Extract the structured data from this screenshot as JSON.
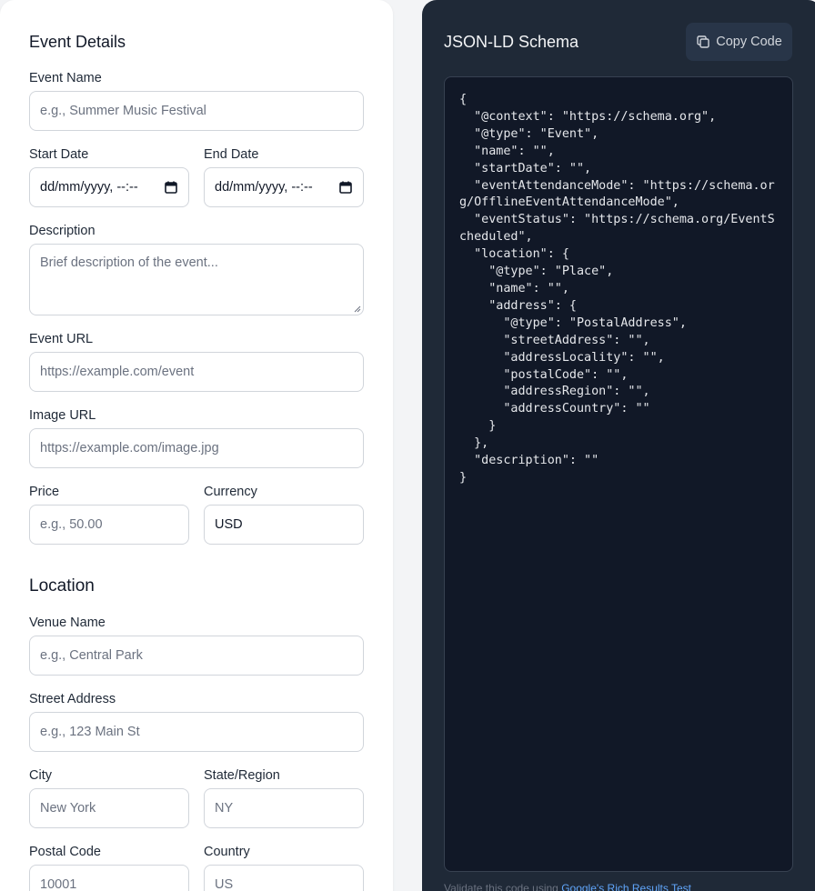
{
  "event_details": {
    "title": "Event Details",
    "event_name": {
      "label": "Event Name",
      "placeholder": "e.g., Summer Music Festival"
    },
    "start_date": {
      "label": "Start Date",
      "value": "dd/mm/yyyy, --:--"
    },
    "end_date": {
      "label": "End Date",
      "value": "dd/mm/yyyy, --:--"
    },
    "description": {
      "label": "Description",
      "placeholder": "Brief description of the event..."
    },
    "event_url": {
      "label": "Event URL",
      "placeholder": "https://example.com/event"
    },
    "image_url": {
      "label": "Image URL",
      "placeholder": "https://example.com/image.jpg"
    },
    "price": {
      "label": "Price",
      "placeholder": "e.g., 50.00"
    },
    "currency": {
      "label": "Currency",
      "value": "USD"
    }
  },
  "location": {
    "title": "Location",
    "venue_name": {
      "label": "Venue Name",
      "placeholder": "e.g., Central Park"
    },
    "street_address": {
      "label": "Street Address",
      "placeholder": "e.g., 123 Main St"
    },
    "city": {
      "label": "City",
      "placeholder": "New York"
    },
    "state_region": {
      "label": "State/Region",
      "placeholder": "NY"
    },
    "postal_code": {
      "label": "Postal Code",
      "placeholder": "10001"
    },
    "country": {
      "label": "Country",
      "placeholder": "US"
    }
  },
  "schema_panel": {
    "title": "JSON-LD Schema",
    "copy_label": "Copy Code",
    "copy_icon": "copy-icon",
    "code": "{\n  \"@context\": \"https://schema.org\",\n  \"@type\": \"Event\",\n  \"name\": \"\",\n  \"startDate\": \"\",\n  \"eventAttendanceMode\": \"https://schema.org/OfflineEventAttendanceMode\",\n  \"eventStatus\": \"https://schema.org/EventScheduled\",\n  \"location\": {\n    \"@type\": \"Place\",\n    \"name\": \"\",\n    \"address\": {\n      \"@type\": \"PostalAddress\",\n      \"streetAddress\": \"\",\n      \"addressLocality\": \"\",\n      \"postalCode\": \"\",\n      \"addressRegion\": \"\",\n      \"addressCountry\": \"\"\n    }\n  },\n  \"description\": \"\"\n}",
    "validate_prefix": "Validate this code using ",
    "validate_link": "Google's Rich Results Test"
  },
  "colors": {
    "code_panel_bg": "#1f2937",
    "code_box_bg": "#111827",
    "link": "#60a5fa"
  }
}
